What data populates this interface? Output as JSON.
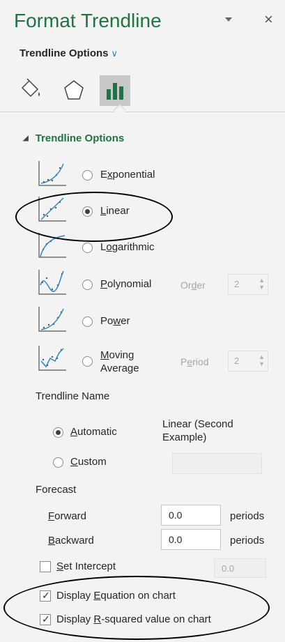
{
  "header": {
    "title": "Format Trendline",
    "close_glyph": "×"
  },
  "subheader": {
    "label": "Trendline Options",
    "chevron": "∨"
  },
  "tabs": [
    {
      "name": "fill-line",
      "icon": "paint-bucket-icon"
    },
    {
      "name": "effects",
      "icon": "pentagon-icon"
    },
    {
      "name": "trendline-options",
      "icon": "bar-chart-icon",
      "active": true
    }
  ],
  "section": {
    "title": "Trendline Options"
  },
  "types": [
    {
      "pre": "E",
      "u": "x",
      "post": "ponential",
      "selected": false
    },
    {
      "pre": "",
      "u": "L",
      "post": "inear",
      "selected": true
    },
    {
      "pre": "L",
      "u": "o",
      "post": "garithmic",
      "selected": false
    },
    {
      "pre": "",
      "u": "P",
      "post": "olynomial",
      "selected": false
    },
    {
      "pre": "Po",
      "u": "w",
      "post": "er",
      "selected": false
    },
    {
      "pre": "",
      "u": "M",
      "post": "oving",
      "line2": "Average",
      "selected": false
    }
  ],
  "order": {
    "pre": "Or",
    "u": "d",
    "post": "er",
    "value": "2"
  },
  "period": {
    "pre": "P",
    "u": "e",
    "post": "riod",
    "value": "2"
  },
  "trendline_name": {
    "label": "Trendline Name",
    "automatic": {
      "pre": "",
      "u": "A",
      "post": "utomatic"
    },
    "automatic_value_line1": "Linear (Second",
    "automatic_value_line2": "Example)",
    "custom": {
      "pre": "",
      "u": "C",
      "post": "ustom"
    }
  },
  "forecast": {
    "label": "Forecast",
    "forward": {
      "pre": "",
      "u": "F",
      "post": "orward",
      "value": "0.0",
      "unit": "periods"
    },
    "backward": {
      "pre": "",
      "u": "B",
      "post": "ackward",
      "value": "0.0",
      "unit": "periods"
    }
  },
  "intercept": {
    "pre": "",
    "u": "S",
    "post": "et Intercept",
    "value": "0.0",
    "checked": false
  },
  "display_equation": {
    "pre": "Display ",
    "u": "E",
    "post": "quation on chart",
    "checked": true
  },
  "display_rsquared": {
    "pre": "Display ",
    "u": "R",
    "post": "-squared value on chart",
    "checked": true
  },
  "colors": {
    "accent": "#217346",
    "chevron": "#2b79d0",
    "trend_line": "#2e86c1"
  }
}
